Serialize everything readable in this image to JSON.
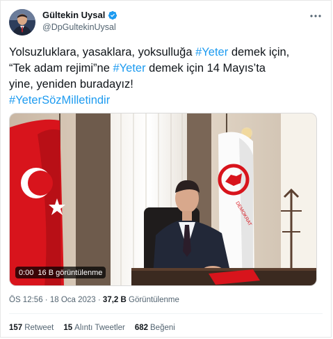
{
  "author": {
    "name": "Gültekin Uysal",
    "handle": "@DpGultekinUysal",
    "verified_color": "#1d9bf0"
  },
  "tweet": {
    "line1_a": "Yolsuzluklara, yasaklara, yoksulluğa ",
    "line1_tag": "#Yeter",
    "line1_b": " demek için,",
    "line2_a": "“Tek adam rejimi”ne ",
    "line2_tag": "#Yeter",
    "line2_b": " demek için 14 Mayıs’ta",
    "line3": "yine, yeniden buradayız!",
    "line4_tag": "#YeterSözMilletindir"
  },
  "video": {
    "duration": "0:00",
    "views": "16 B görüntülenme",
    "emblem_text": "DEMOKRAT"
  },
  "meta": {
    "time": "ÖS 12:56",
    "separator1": " · ",
    "date": "18 Oca 2023",
    "separator2": " · ",
    "views_count": "37,2 B",
    "views_label": " Görüntülenme"
  },
  "stats": {
    "retweets_count": "157",
    "retweets_label": "Retweet",
    "quotes_count": "15",
    "quotes_label": "Alıntı Tweetler",
    "likes_count": "682",
    "likes_label": "Beğeni"
  },
  "colors": {
    "accent": "#1d9bf0",
    "secondary_text": "#536471",
    "flag_red": "#d8141c"
  },
  "icons": {
    "more": "more-dots-icon",
    "verified": "verified-badge-icon"
  }
}
